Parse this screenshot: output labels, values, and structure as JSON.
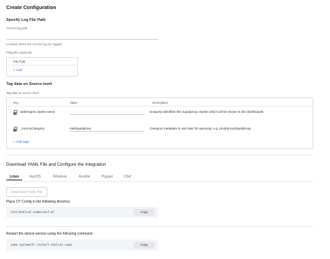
{
  "header": {
    "title": "Create Configuration"
  },
  "log_path": {
    "section_title": "Specify Log File Path",
    "field_label": "Access log path",
    "value": "",
    "helper": "Location where the Access log are logged."
  },
  "filepaths": {
    "label": "Filepaths (optional)",
    "column": "File Path",
    "add_label": "+ Add"
  },
  "tags": {
    "section_title": "Tag data on Source level",
    "subtitle": "Tag data on source level",
    "columns": {
      "key": "Key",
      "value": "Value",
      "description": "Description"
    },
    "rows": [
      {
        "key": "webengine.cluster.name",
        "value": "",
        "description": "Uniquely identifies this squidproxy cluster which will be shown in the dashboards"
      },
      {
        "key": "_sourceCategory",
        "value": "otel/squidproxy",
        "description": "Category metadata to use later for querying, e.g. prod/proxy/squidproxy."
      }
    ],
    "add_label": "+ Add tags"
  },
  "download": {
    "section_title": "Download YAML File and Configure the Integration",
    "tabs": [
      "Linux",
      "macOS",
      "Windows",
      "Ansible",
      "Puppet",
      "Chef"
    ],
    "active_tab": "Linux",
    "button_label": "Download YAML File",
    "step1_title": "Place OT Config in the following directory",
    "step1_code": "/etc/otelcol-sumo/conf.d/",
    "step2_title": "Restart the otelcol-service using the following command",
    "step2_code": "sudo systemctl restart otelcol-sumo",
    "copy_label": "Copy"
  },
  "icons": {
    "lock": "lock-icon"
  },
  "colors": {
    "link": "#2563eb",
    "text": "#1f2733"
  }
}
